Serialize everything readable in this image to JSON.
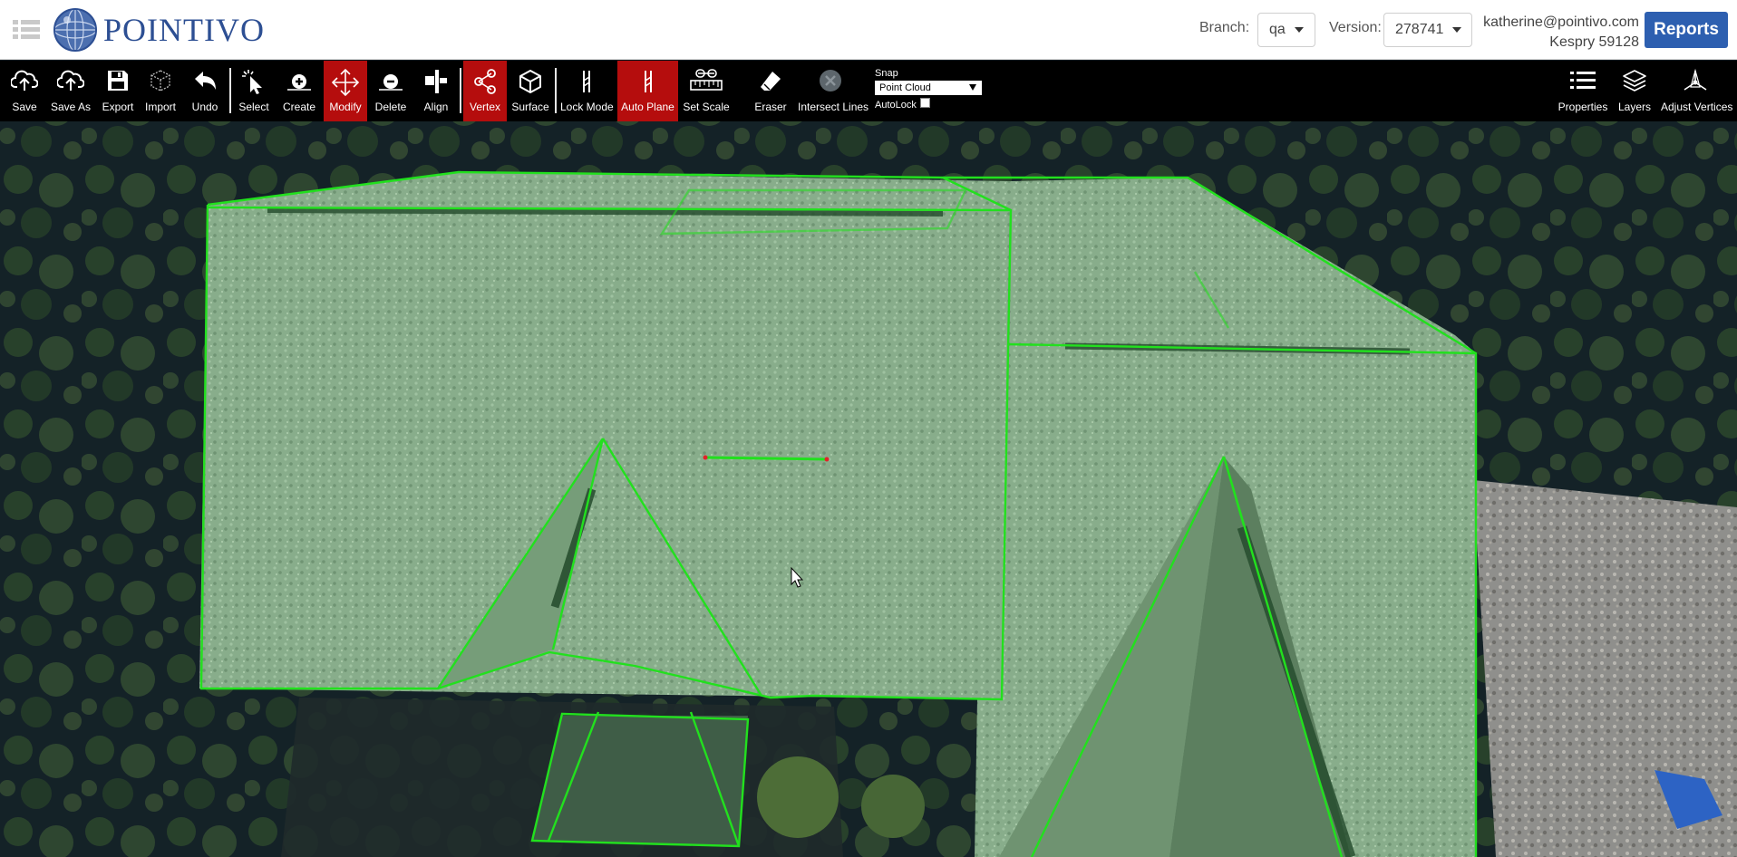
{
  "header": {
    "logo_text": "POINTIVO",
    "branch_label": "Branch:",
    "branch_value": "qa",
    "version_label": "Version:",
    "version_value": "278741",
    "user_email": "katherine@pointivo.com",
    "user_project": "Kespry 59128",
    "reports_label": "Reports"
  },
  "toolbar": {
    "save": "Save",
    "save_as": "Save As",
    "export": "Export",
    "import": "Import",
    "undo": "Undo",
    "select": "Select",
    "create": "Create",
    "modify": "Modify",
    "delete": "Delete",
    "align": "Align",
    "vertex": "Vertex",
    "surface": "Surface",
    "lock_mode": "Lock Mode",
    "auto_plane": "Auto Plane",
    "set_scale": "Set Scale",
    "eraser": "Eraser",
    "intersect_lines": "Intersect Lines",
    "snap_label": "Snap",
    "snap_value": "Point Cloud",
    "autolock_label": "AutoLock",
    "properties": "Properties",
    "layers": "Layers",
    "adjust_vertices": "Adjust Vertices"
  },
  "colors": {
    "brand_blue": "#2d4f93",
    "reports_blue": "#2d5fb0",
    "active_tool_red": "#b50d0d",
    "wireframe_green": "#22e01e",
    "roof_fill": "#86b08c"
  }
}
